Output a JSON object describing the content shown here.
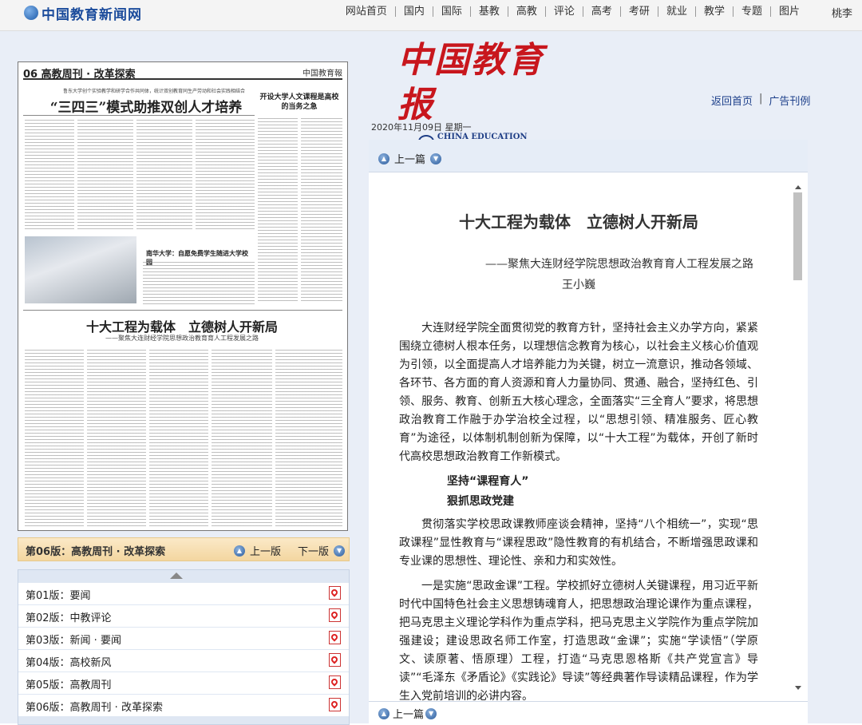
{
  "site": {
    "logo_text": "中国教育新闻网"
  },
  "topnav": {
    "items": [
      "网站首页",
      "国内",
      "国际",
      "基教",
      "高教",
      "评论",
      "高考",
      "考研",
      "就业",
      "教学",
      "专题",
      "图片"
    ],
    "tail": "桃李"
  },
  "masthead": {
    "title": "中国教育报",
    "english": "CHINA EDUCATION DAILY"
  },
  "header_links": {
    "home": "返回首页",
    "ads": "广告刊例"
  },
  "date": "2020年11月09日 星期一",
  "paper_preview": {
    "page_head": "06 高教周刊 · 改革探索",
    "masthead_small": "中国教育報",
    "headline_1": "“三四三”模式助推双创人才培养",
    "subhead_1": "鲁东大学创个实验教学和研学合作共同体，统计双创教育同生产劳动和社会实践相结合",
    "box_title": "开设大学人文课程是高校的当务之急",
    "photo_caption": "南华大学：自愿免费学生随进大学校园",
    "headline_2": "十大工程为载体　立德树人开新局",
    "subhead_2": "——聚焦大连财经学院思想政治教育育人工程发展之路"
  },
  "page_bar": {
    "current": "第06版：高教周刊 · 改革探索",
    "prev": "上一版",
    "next": "下一版"
  },
  "page_list": [
    {
      "label": "第01版：要闻"
    },
    {
      "label": "第02版：中教评论"
    },
    {
      "label": "第03版：新闻 · 要闻"
    },
    {
      "label": "第04版：高校新风"
    },
    {
      "label": "第05版：高教周刊"
    },
    {
      "label": "第06版：高教周刊 · 改革探索"
    }
  ],
  "article_nav": {
    "prev": "上一篇",
    "prev_bottom": "上一篇"
  },
  "article": {
    "title": "十大工程为载体　立德树人开新局",
    "subtitle": "——聚焦大连财经学院思想政治教育育人工程发展之路",
    "author": "王小巍",
    "para1": "大连财经学院全面贯彻党的教育方针，坚持社会主义办学方向，紧紧围绕立德树人根本任务，以理想信念教育为核心，以社会主义核心价值观为引领，以全面提高人才培养能力为关键，树立一流意识，推动各领域、各环节、各方面的育人资源和育人力量协同、贯通、融合，坚持红色、引领、服务、教育、创新五大核心理念，全面落实“三全育人”要求，将思想政治教育工作融于办学治校全过程，以“思想引领、精准服务、匠心教育”为途径，以体制机制创新为保障，以“十大工程”为载体，开创了新时代高校思想政治教育工作新模式。",
    "h1": "坚持“课程育人”",
    "h2": "狠抓思政党建",
    "para2": "贯彻落实学校思政课教师座谈会精神，坚持“八个相统一”，实现“思政课程”显性教育与“课程思政”隐性教育的有机结合，不断增强思政课和专业课的思想性、理论性、亲和力和实效性。",
    "para3": "一是实施“思政金课”工程。学校抓好立德树人关键课程，用习近平新时代中国特色社会主义思想铸魂育人，把思想政治理论课作为重点课程，把马克思主义理论学科作为重点学科，把马克思主义学院作为重点学院加强建设；建设思政名师工作室，打造思政“金课”；实施“学读悟”（学原文、读原著、悟原理）工程，打造“马克思恩格斯《共产党宣言》导读”“毛泽东《矛盾论》《实践论》导读”等经典著作导读精品课程，作为学生入党前培训的必讲内容。"
  }
}
